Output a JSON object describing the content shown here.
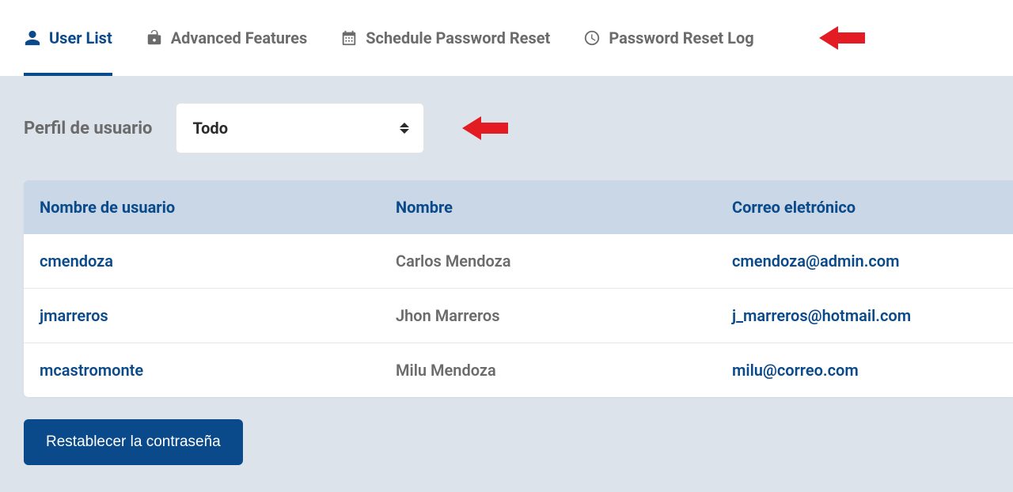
{
  "tabs": [
    {
      "label": "User List",
      "icon": "user-icon",
      "active": true
    },
    {
      "label": "Advanced Features",
      "icon": "lock-open-icon",
      "active": false
    },
    {
      "label": "Schedule Password Reset",
      "icon": "calendar-icon",
      "active": false
    },
    {
      "label": "Password Reset Log",
      "icon": "clock-icon",
      "active": false
    }
  ],
  "filter": {
    "label": "Perfil de usuario",
    "selected": "Todo"
  },
  "table": {
    "headers": {
      "username": "Nombre de usuario",
      "fullname": "Nombre",
      "email": "Correo eletrónico"
    },
    "rows": [
      {
        "username": "cmendoza",
        "fullname": "Carlos Mendoza",
        "email": "cmendoza@admin.com"
      },
      {
        "username": "jmarreros",
        "fullname": "Jhon Marreros",
        "email": "j_marreros@hotmail.com"
      },
      {
        "username": "mcastromonte",
        "fullname": "Milu Mendoza",
        "email": "milu@correo.com"
      }
    ]
  },
  "button": {
    "reset_label": "Restablecer la contraseña"
  },
  "annotations": {
    "arrow_color": "#e31b23"
  }
}
